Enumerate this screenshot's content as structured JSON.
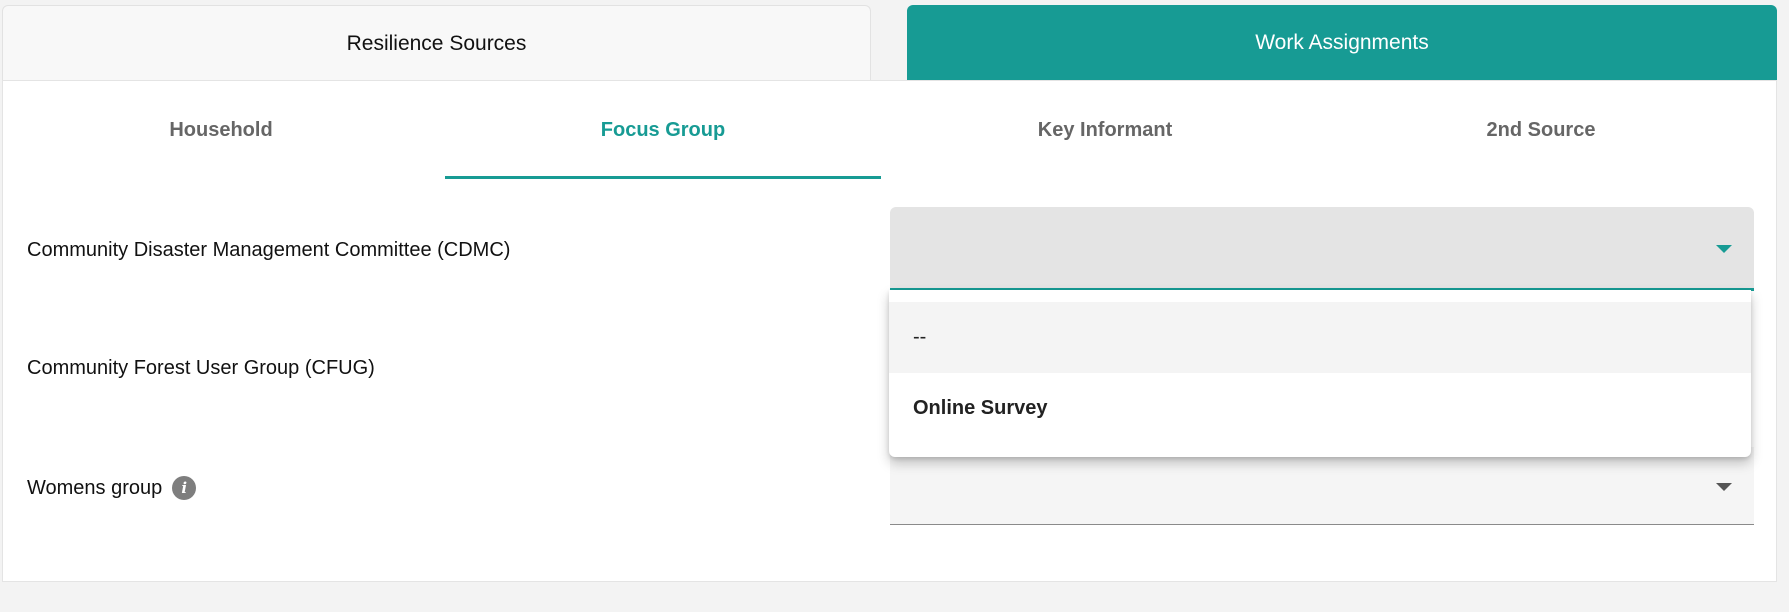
{
  "top_tabs": [
    {
      "label": "Resilience Sources",
      "active": false
    },
    {
      "label": "Work Assignments",
      "active": true
    }
  ],
  "sub_tabs": [
    {
      "label": "Household"
    },
    {
      "label": "Focus Group",
      "active": true
    },
    {
      "label": "Key Informant"
    },
    {
      "label": "2nd Source"
    }
  ],
  "rows": [
    {
      "label": "Community Disaster Management Committee (CDMC)",
      "value": ""
    },
    {
      "label": "Community Forest User Group (CFUG)",
      "value": ""
    },
    {
      "label": "Womens group",
      "value": "",
      "info_icon": "info-icon"
    }
  ],
  "dropdown": {
    "options": [
      "--",
      "Online Survey"
    ]
  },
  "colors": {
    "accent": "#179b94",
    "active_tab_text": "#ffffff",
    "inactive_tab_text": "#666666"
  }
}
